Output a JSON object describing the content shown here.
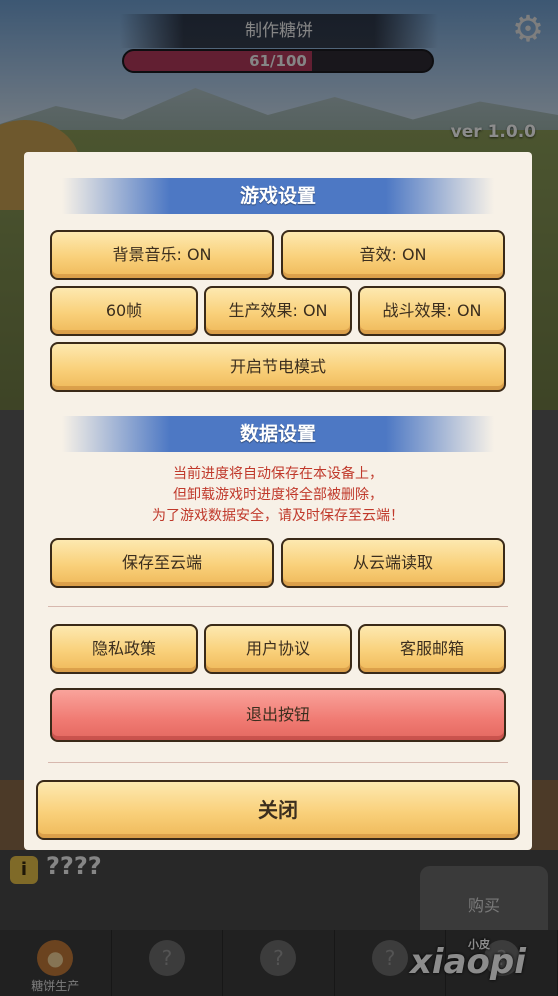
{
  "hud": {
    "title": "制作糖饼",
    "progress_text": "61/100",
    "progress_fraction": 0.61,
    "version": "ver 1.0.0",
    "settings_icon": "gear-icon"
  },
  "background": {
    "info_badge": "i",
    "unknown_label": "????",
    "buy_label": "购买",
    "tabs": [
      {
        "label": "糖饼生产",
        "icon": "cookie-icon"
      },
      {
        "label": "",
        "icon": "?"
      },
      {
        "label": "",
        "icon": "?"
      },
      {
        "label": "",
        "icon": "?"
      },
      {
        "label": "",
        "icon": "?"
      }
    ],
    "watermark_main": "xiaopi",
    "watermark_small": "小皮"
  },
  "settings": {
    "game_section_title": "游戏设置",
    "bgm_label": "背景音乐: ON",
    "sfx_label": "音效: ON",
    "fps_label": "60帧",
    "production_effect_label": "生产效果: ON",
    "battle_effect_label": "战斗效果: ON",
    "power_saving_label": "开启节电模式",
    "data_section_title": "数据设置",
    "notice_lines": [
      "当前进度将自动保存在本设备上，",
      "但卸载游戏时进度将全部被删除，",
      "为了游戏数据安全，请及时保存至云端！"
    ],
    "save_cloud_label": "保存至云端",
    "load_cloud_label": "从云端读取",
    "privacy_label": "隐私政策",
    "user_agreement_label": "用户协议",
    "support_email_label": "客服邮箱",
    "exit_label": "退出按钮",
    "close_label": "关闭"
  },
  "colors": {
    "section_header": "#4d78c4",
    "button_fill": "#f9d07a",
    "exit_button_fill": "#f07a72",
    "notice_text": "#c0392b",
    "panel_bg": "#f7f1e7"
  }
}
